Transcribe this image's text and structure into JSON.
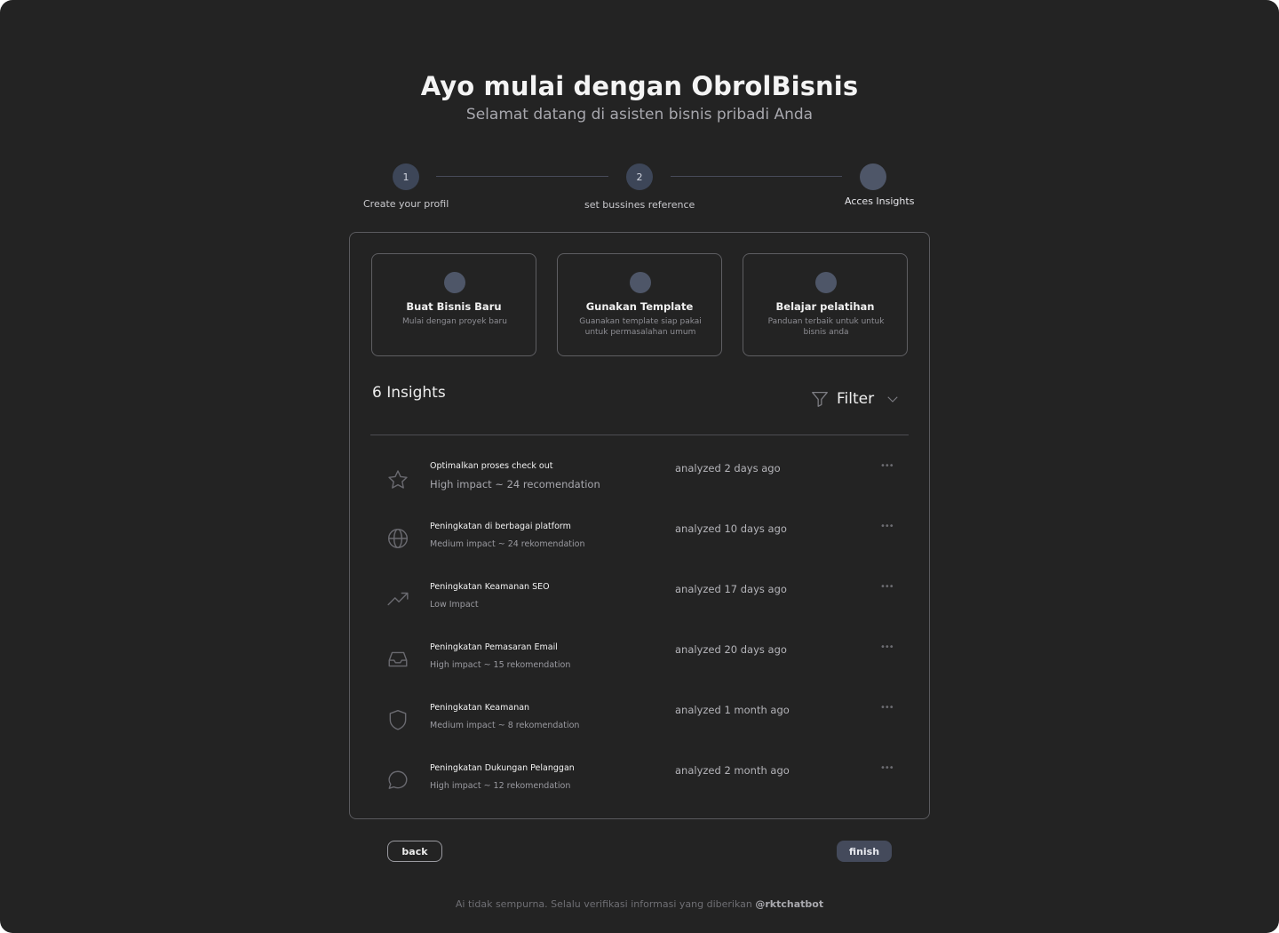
{
  "header": {
    "title": "Ayo mulai dengan ObrolBisnis",
    "subtitle": "Selamat datang di asisten bisnis pribadi Anda"
  },
  "stepper": {
    "steps": [
      {
        "number": "1",
        "label": "Create your profil"
      },
      {
        "number": "2",
        "label": "set bussines reference"
      },
      {
        "number": "",
        "label": "Acces Insights"
      }
    ]
  },
  "cards": [
    {
      "title": "Buat Bisnis Baru",
      "description": "Mulai dengan proyek baru"
    },
    {
      "title": "Gunakan Template",
      "description": "Guanakan template siap pakai untuk permasalahan umum"
    },
    {
      "title": "Belajar pelatihan",
      "description": "Panduan terbaik untuk untuk bisnis anda"
    }
  ],
  "insights": {
    "title": "6 Insights",
    "filter_label": "Filter",
    "items": [
      {
        "icon": "star-icon",
        "title": "Optimalkan proses check out",
        "subtitle": "High impact  ~ 24 recomendation",
        "time": "analyzed 2 days  ago",
        "more": "•••"
      },
      {
        "icon": "globe-icon",
        "title": "Peningkatan di berbagai platform",
        "subtitle": "Medium impact  ~ 24 rekomendation",
        "time": "analyzed 10 days  ago",
        "more": "•••"
      },
      {
        "icon": "trending-up-icon",
        "title": "Peningkatan Keamanan SEO",
        "subtitle": "Low Impact",
        "time": "analyzed 17 days  ago",
        "more": "•••"
      },
      {
        "icon": "inbox-icon",
        "title": "Peningkatan Pemasaran Email",
        "subtitle": "High impact  ~ 15 rekomendation",
        "time": "analyzed 20 days  ago",
        "more": "•••"
      },
      {
        "icon": "shield-icon",
        "title": "Peningkatan Keamanan",
        "subtitle": "Medium impact  ~ 8 rekomendation",
        "time": "analyzed 1 month  ago",
        "more": "•••"
      },
      {
        "icon": "chat-bubble-icon",
        "title": "Peningkatan Dukungan Pelanggan",
        "subtitle": "High impact  ~ 12 rekomendation",
        "time": "analyzed 2 month  ago",
        "more": "•••"
      }
    ]
  },
  "buttons": {
    "back": "back",
    "finish": "finish"
  },
  "footer": {
    "text": "Ai tidak sempurna. Selalu verifikasi informasi yang diberikan ",
    "handle": "@rktchatbot"
  },
  "colors": {
    "background": "#232323",
    "accent": "#3d4658",
    "border": "#5a5a5e"
  }
}
